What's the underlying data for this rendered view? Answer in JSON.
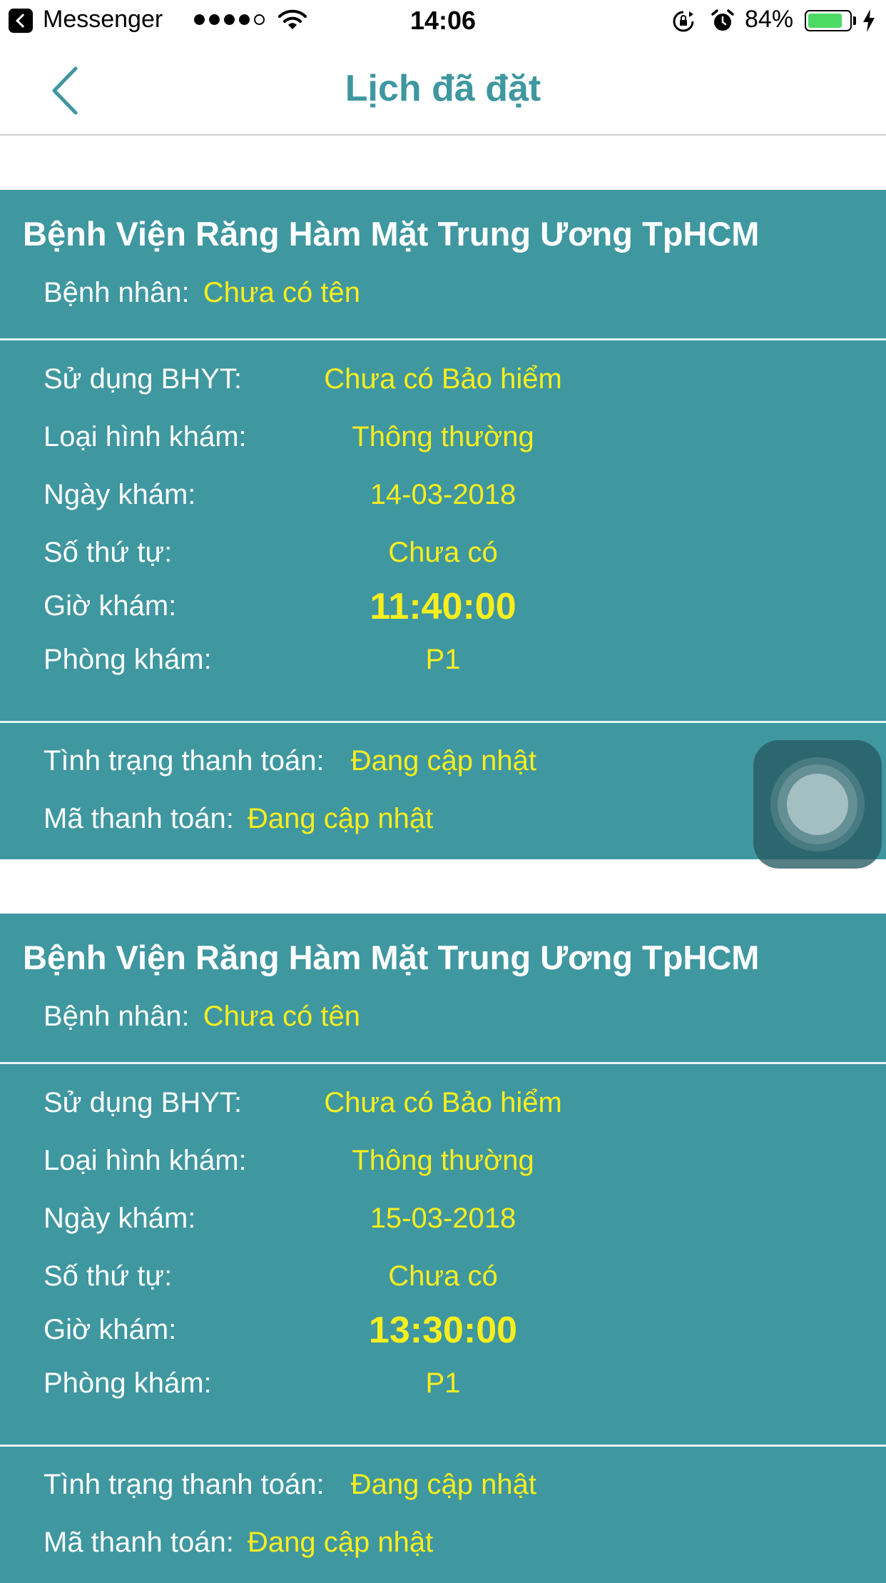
{
  "status_bar": {
    "app": "Messenger",
    "time": "14:06",
    "battery_percent": "84%",
    "battery_level": 0.84,
    "signal_bars_filled": 4,
    "signal_bars_total": 5
  },
  "nav": {
    "title": "Lịch đã đặt",
    "back_icon": "chevron-left-icon"
  },
  "colors": {
    "teal": "#3f97a0",
    "value_yellow": "#f8ee1e",
    "battery_green": "#4cd964"
  },
  "bookings": [
    {
      "hospital": "Bệnh Viện Răng Hàm Mặt Trung Ương TpHCM",
      "patient_label": "Bệnh nhân:",
      "patient_value": "Chưa có tên",
      "insurance_label": "Sử dụng BHYT:",
      "insurance_value": "Chưa có Bảo hiểm",
      "type_label": "Loại hình khám:",
      "type_value": "Thông thường",
      "date_label": "Ngày khám:",
      "date_value": "14-03-2018",
      "queue_label": "Số thứ tự:",
      "queue_value": "Chưa có",
      "time_label": "Giờ khám:",
      "time_value": "11:40:00",
      "room_label": "Phòng khám:",
      "room_value": "P1",
      "payment_status_label": "Tình trạng thanh toán:",
      "payment_status_value": "Đang cập nhật",
      "payment_code_label": "Mã thanh toán:",
      "payment_code_value": "Đang cập nhật"
    },
    {
      "hospital": "Bệnh Viện Răng Hàm Mặt Trung Ương TpHCM",
      "patient_label": "Bệnh nhân:",
      "patient_value": "Chưa có tên",
      "insurance_label": "Sử dụng BHYT:",
      "insurance_value": "Chưa có Bảo hiểm",
      "type_label": "Loại hình khám:",
      "type_value": "Thông thường",
      "date_label": "Ngày khám:",
      "date_value": "15-03-2018",
      "queue_label": "Số thứ tự:",
      "queue_value": "Chưa có",
      "time_label": "Giờ khám:",
      "time_value": "13:30:00",
      "room_label": "Phòng khám:",
      "room_value": "P1",
      "payment_status_label": "Tình trạng thanh toán:",
      "payment_status_value": "Đang cập nhật",
      "payment_code_label": "Mã thanh toán:",
      "payment_code_value": "Đang cập nhật"
    }
  ]
}
